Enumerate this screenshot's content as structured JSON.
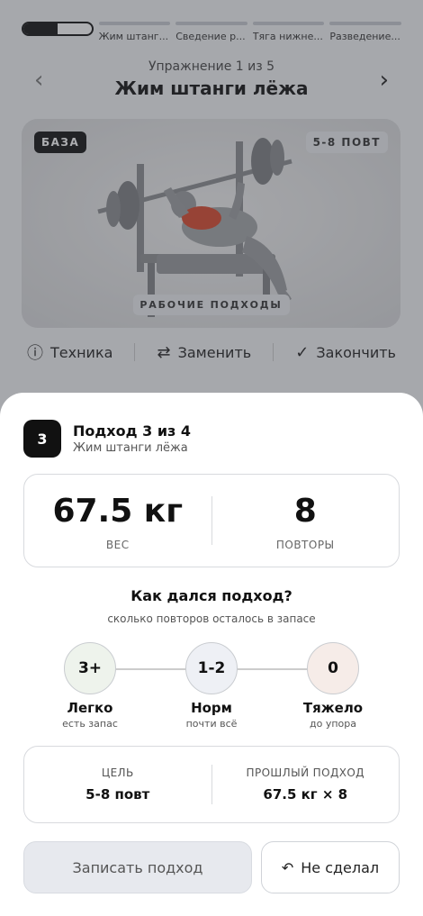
{
  "progress": {
    "segments": [
      {
        "label": "",
        "active": true,
        "fill": 0.5
      },
      {
        "label": "Жим штанг..."
      },
      {
        "label": "Сведение р..."
      },
      {
        "label": "Тяга нижне..."
      },
      {
        "label": "Разведение..."
      }
    ]
  },
  "nav": {
    "counter": "Упражнение 1 из 5",
    "title": "Жим штанги лёжа",
    "prev_icon": "chevron-left-icon",
    "next_icon": "chevron-right-icon"
  },
  "hero": {
    "badge_left": "БАЗА",
    "badge_right": "5-8 ПОВТ",
    "badge_bottom": "РАБОЧИЕ ПОДХОДЫ"
  },
  "actions": {
    "technique": "Техника",
    "replace": "Заменить",
    "finish": "Закончить"
  },
  "sheet": {
    "set_number": "3",
    "title": "Подход 3 из 4",
    "subtitle": "Жим штанги лёжа",
    "weight_value": "67.5 кг",
    "weight_label": "ВЕС",
    "reps_value": "8",
    "reps_label": "ПОВТОРЫ",
    "question": "Как дался подход?",
    "question_hint": "сколько повторов осталось в запасе",
    "options": [
      {
        "value": "3+",
        "name": "Легко",
        "hint": "есть запас",
        "color": "#eef3ec"
      },
      {
        "value": "1-2",
        "name": "Норм",
        "hint": "почти всё",
        "color": "#eef0f5"
      },
      {
        "value": "0",
        "name": "Тяжело",
        "hint": "до упора",
        "color": "#f6ece8"
      }
    ],
    "goal_label": "ЦЕЛЬ",
    "goal_value": "5-8 повт",
    "prev_label": "ПРОШЛЫЙ ПОДХОД",
    "prev_value": "67.5 кг × 8",
    "record_button": "Записать подход",
    "skip_button": "Не сделал"
  }
}
